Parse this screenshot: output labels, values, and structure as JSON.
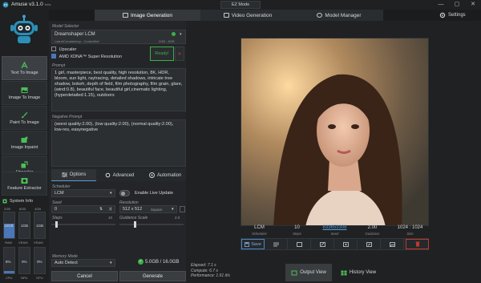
{
  "app": {
    "title": "Amuse v3.1.0",
    "beta": "beta",
    "ez_mode": "EZ Mode"
  },
  "window": {
    "minimize": "—",
    "maximize": "▢",
    "close": "✕"
  },
  "tabs": [
    {
      "label": "Image Generation",
      "icon": "image-icon",
      "active": true
    },
    {
      "label": "Video Generation",
      "icon": "video-icon",
      "active": false
    },
    {
      "label": "Model Manager",
      "icon": "cube-icon",
      "active": false
    }
  ],
  "settings_label": "Settings",
  "sidebar": {
    "items": [
      {
        "label": "Text To Image",
        "icon": "text-a-icon",
        "active": true
      },
      {
        "label": "Image To Image",
        "icon": "image-icon",
        "active": false
      },
      {
        "label": "Paint To Image",
        "icon": "brush-icon",
        "active": false
      },
      {
        "label": "Image Inpaint",
        "icon": "inpaint-icon",
        "active": false
      },
      {
        "label": "Upscaler",
        "icon": "upscale-icon",
        "active": false
      },
      {
        "label": "Feature Extractor",
        "icon": "feature-icon",
        "active": false
      }
    ],
    "system_info": {
      "title": "System Info",
      "labels_top": [
        "2GB",
        "8GB",
        "4GB"
      ],
      "mem_values": [
        "16GB",
        "1GB",
        "1GB"
      ],
      "mem_row2": [
        "RAM",
        "VRAM",
        "VRAM"
      ],
      "usage_values": [
        "8%",
        "0%",
        "0%"
      ],
      "usage_labels": [
        "CPU",
        "NPU",
        "GPU"
      ]
    }
  },
  "model_selector": {
    "label": "Model Selector",
    "model_name": "Dreamshaper LCM",
    "model_sub": "LatentConsistency - ControlNet",
    "model_meta": "2GB - 8GB",
    "ready": "Ready!",
    "upscaler_label": "Upscaler",
    "super_res_label": "AMD XDNA™ Super Resolution"
  },
  "prompt": {
    "label": "Prompt",
    "text": "1 girl, masterpiece, best quality, high resolution, 8K, HDR, bloom, sun light, raytracing, detailed shadows, intricate tree shadow, bokeh, depth of field, film photography, film grain, glare, (wind:0.8), beautiful face, beautiful girl,cinematic lighting, (hyperdetailed:1.15), outdoors"
  },
  "negative_prompt": {
    "label": "Negative Prompt",
    "text": "(worst quality:2.00), (low quality:2.00), (normal quality:2.00), low-res, easynegative"
  },
  "subtabs": [
    {
      "label": "Options",
      "active": true
    },
    {
      "label": "Advanced",
      "active": false
    },
    {
      "label": "Automation",
      "active": false
    }
  ],
  "options": {
    "scheduler_label": "Scheduler",
    "scheduler_value": "LCM",
    "live_update_label": "Enable Live Update",
    "seed_label": "Seed",
    "seed_value": "0",
    "resolution_label": "Resolution",
    "resolution_value": "512 x 512",
    "resolution_aspect": "Square",
    "steps_label": "Steps",
    "steps_max": "10",
    "guidance_label": "Guidance Scale",
    "guidance_max": "2.0",
    "steps_fraction": 0.06,
    "guidance_fraction": 0.22
  },
  "memory_mode": {
    "label": "Memory Mode",
    "value": "Auto Detect",
    "usage": "5.0GB / 16.0GB"
  },
  "actions": {
    "cancel": "Cancel",
    "generate": "Generate"
  },
  "image_details": {
    "scheduler": "LCM",
    "scheduler_cap": "Scheduler",
    "steps": "10",
    "steps_cap": "Steps",
    "seed": "833653308",
    "seed_cap": "Seed",
    "guidance": "2.00",
    "guidance_cap": "Guidance",
    "size": "1024 : 1024",
    "size_cap": "Size"
  },
  "toolbar": {
    "save": "Save"
  },
  "timing": {
    "elapsed": "Elapsed: 7.1 s",
    "compute": "Compute: 6.7 s",
    "performance": "Performance: 1.61 it/s"
  },
  "view_buttons": [
    {
      "label": "Output View",
      "active": true
    },
    {
      "label": "History View",
      "active": false
    }
  ],
  "colors": {
    "accent": "#4a77b8",
    "ready_green": "#3fae4a",
    "danger": "#c0392b",
    "seed_link": "#5a9bd5"
  }
}
